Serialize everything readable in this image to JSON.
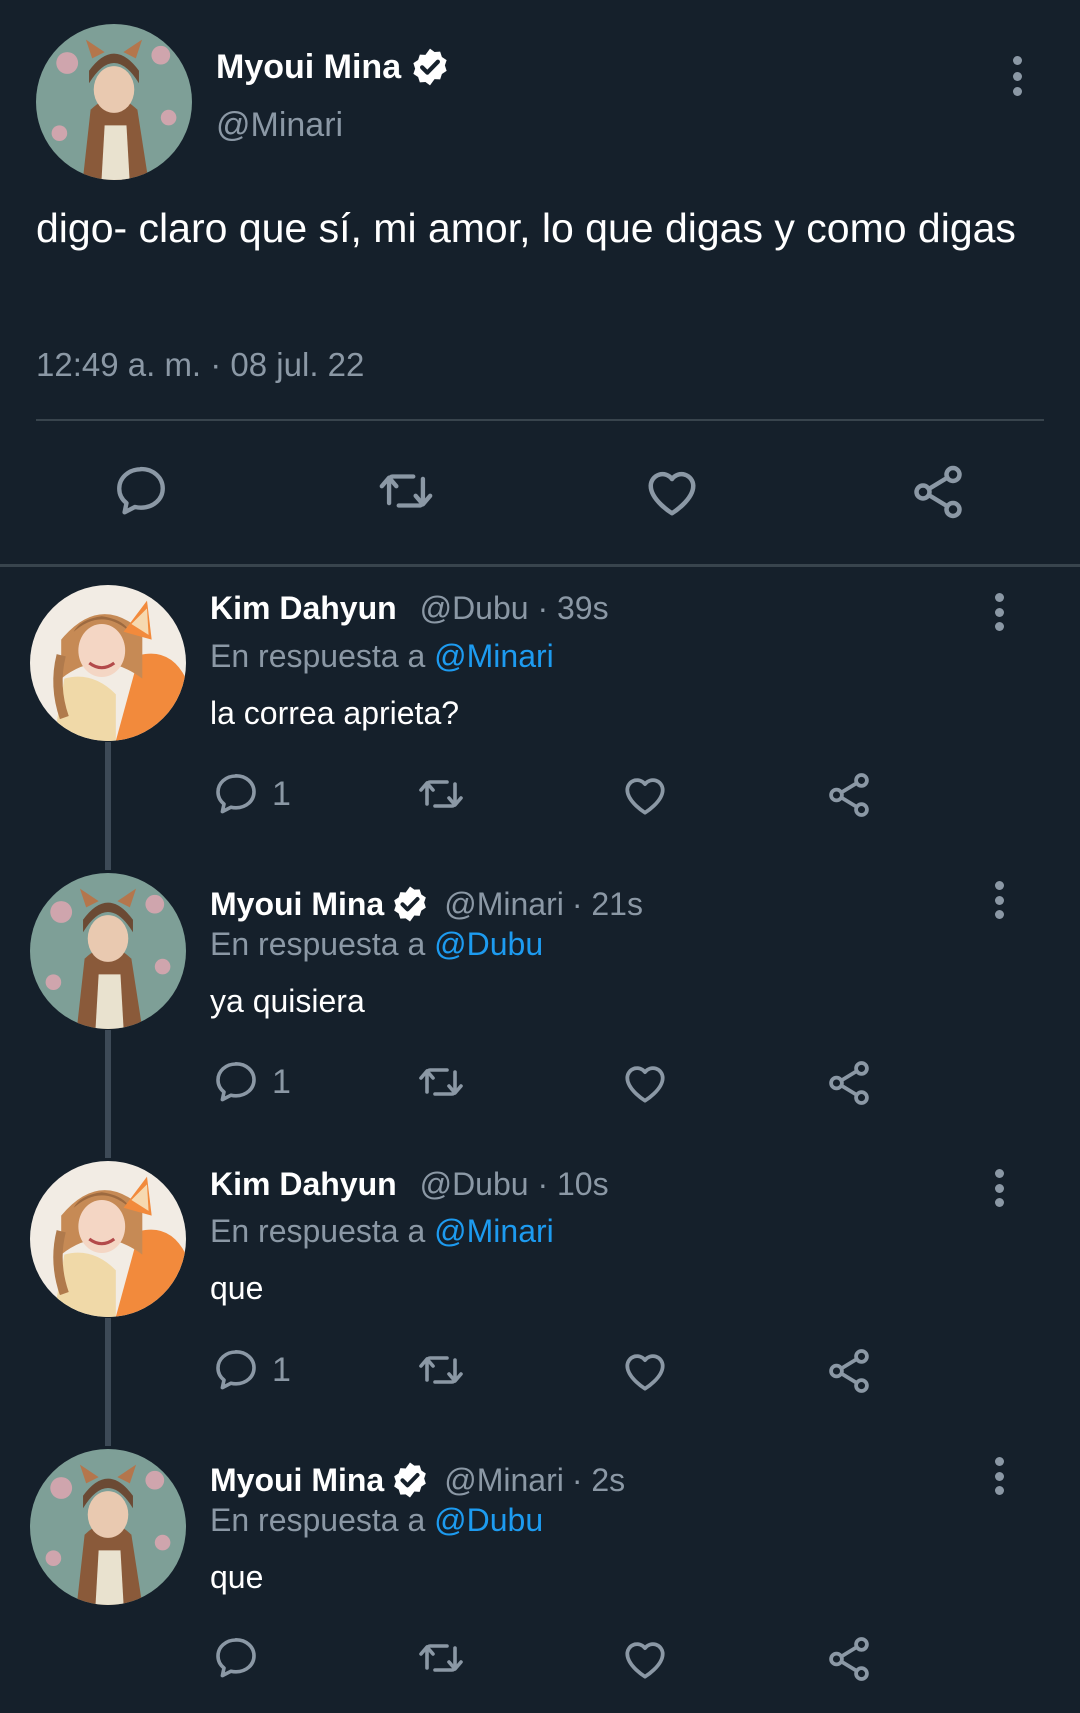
{
  "main_tweet": {
    "name": "Myoui Mina",
    "handle": "@Minari",
    "text": "digo- claro que sí, mi amor, lo que digas y como digas",
    "timestamp": "12:49 a. m. · 08 jul. 22"
  },
  "replies": [
    {
      "name": "Kim Dahyun",
      "handle": "@Dubu",
      "time": "· 39s",
      "reply_prefix": "En respuesta a",
      "reply_to": "@Minari",
      "text": "la correa aprieta?",
      "reply_count": "1",
      "verified": false
    },
    {
      "name": "Myoui Mina",
      "handle": "@Minari",
      "time": "· 21s",
      "reply_prefix": "En respuesta a",
      "reply_to": "@Dubu",
      "text": "ya quisiera",
      "reply_count": "1",
      "verified": true
    },
    {
      "name": "Kim Dahyun",
      "handle": "@Dubu",
      "time": "· 10s",
      "reply_prefix": "En respuesta a",
      "reply_to": "@Minari",
      "text": "que",
      "reply_count": "1",
      "verified": false
    },
    {
      "name": "Myoui Mina",
      "handle": "@Minari",
      "time": "· 2s",
      "reply_prefix": "En respuesta a",
      "reply_to": "@Dubu",
      "text": "que",
      "reply_count": "",
      "verified": true
    }
  ],
  "colors": {
    "background": "#15202b",
    "text": "#ffffff",
    "muted": "#8b98a5",
    "link": "#1d9bf0",
    "divider": "#38444d"
  },
  "icons": [
    "comment-icon",
    "retweet-icon",
    "like-icon",
    "share-icon",
    "more-icon",
    "verified-badge-icon"
  ]
}
